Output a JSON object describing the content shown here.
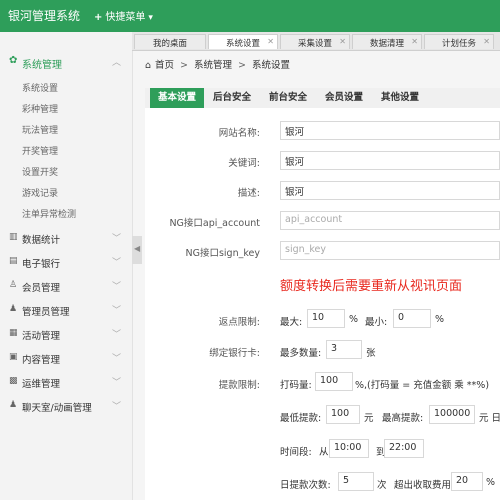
{
  "header": {
    "brand": "银河管理系统",
    "quick_menu": "快捷菜单",
    "plus_icon": "+",
    "chevron": "⌄"
  },
  "sidebar": {
    "active_group": {
      "label": "系统管理",
      "icon": "gear-icon",
      "glyph": "✿"
    },
    "sub_items": [
      "系统设置",
      "彩种管理",
      "玩法管理",
      "开奖管理",
      "设置开奖",
      "游戏记录",
      "注单异常检测"
    ],
    "groups": [
      {
        "label": "数据统计",
        "glyph": "▥"
      },
      {
        "label": "电子银行",
        "glyph": "▤"
      },
      {
        "label": "会员管理",
        "glyph": "♙"
      },
      {
        "label": "管理员管理",
        "glyph": "♟"
      },
      {
        "label": "活动管理",
        "glyph": "▦"
      },
      {
        "label": "内容管理",
        "glyph": "▣"
      },
      {
        "label": "运维管理",
        "glyph": "▩"
      },
      {
        "label": "聊天室/动画管理",
        "glyph": "♟"
      }
    ]
  },
  "page_tabs": [
    "我的桌面",
    "系统设置",
    "采集设置",
    "数据清理",
    "计划任务"
  ],
  "breadcrumb": {
    "home": "首页",
    "level1": "系统管理",
    "level2": "系统设置",
    "sep": ">"
  },
  "settings_tabs": [
    "基本设置",
    "后台安全",
    "前台安全",
    "会员设置",
    "其他设置"
  ],
  "form": {
    "site_name": {
      "label": "网站名称:",
      "value": "银河"
    },
    "keywords": {
      "label": "关键词:",
      "value": "银河"
    },
    "description": {
      "label": "描述:",
      "value": "银河"
    },
    "api_account": {
      "label": "NG接口api_account",
      "placeholder": "api_account"
    },
    "sign_key": {
      "label": "NG接口sign_key",
      "placeholder": "sign_key"
    },
    "notice": "额度转换后需要重新从视讯页面",
    "rebate": {
      "label": "返点限制:",
      "max_label": "最大:",
      "max": "10",
      "min_label": "最小:",
      "min": "0",
      "unit": "%"
    },
    "bind_card": {
      "label": "绑定银行卡:",
      "max_label": "最多数量:",
      "max": "3",
      "unit": "张"
    },
    "withdraw": {
      "label": "提款限制:",
      "betting_label": "打码量:",
      "betting": "100",
      "betting_note": "%,(打码量 = 充值金额 乘 **%)",
      "min_label": "最低提款:",
      "min": "100",
      "yuan": "元",
      "max_label": "最高提款:",
      "max": "100000",
      "max_suffix": "元 日提",
      "period_label": "时间段:",
      "from_label": "从",
      "from": "10:00",
      "to_label": "到",
      "to": "22:00",
      "daily_label": "日提款次数:",
      "daily": "5",
      "times": "次",
      "fee_label": "超出收取费用",
      "fee": "20",
      "fee_unit": "%"
    }
  },
  "colors": {
    "primary": "#2e9e5a",
    "notice": "#e8281e"
  }
}
